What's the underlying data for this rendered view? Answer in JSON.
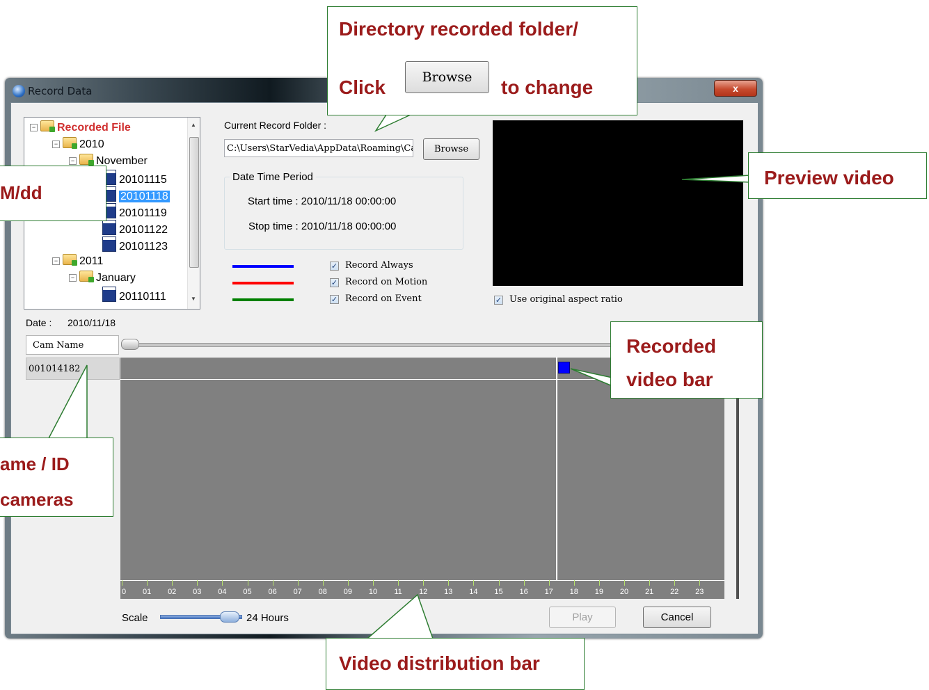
{
  "window": {
    "title": "Record Data",
    "close_label": "x"
  },
  "tree": {
    "root": "Recorded File",
    "year1": "2010",
    "month1": "November",
    "days1": [
      "20101115",
      "20101118",
      "20101119",
      "20101122",
      "20101123"
    ],
    "year2": "2011",
    "month2": "January",
    "days2": [
      "20110111"
    ]
  },
  "folder": {
    "label": "Current Record Folder :",
    "path": "C:\\Users\\StarVedia\\AppData\\Roaming\\Car",
    "browse_label": "Browse"
  },
  "period": {
    "title": "Date Time Period",
    "start": "Start time : 2010/11/18 00:00:00",
    "stop": "Stop time : 2010/11/18 00:00:00"
  },
  "legend": [
    {
      "label": "Record Always",
      "color": "#0000ff",
      "checked": true
    },
    {
      "label": "Record on Motion",
      "color": "#ff0000",
      "checked": true
    },
    {
      "label": "Record on Event",
      "color": "#008000",
      "checked": true
    }
  ],
  "preview": {
    "aspect_label": "Use original aspect ratio",
    "checked": true
  },
  "date": {
    "label": "Date :",
    "value": "2010/11/18"
  },
  "timeline": {
    "cam_header": "Cam Name",
    "cam_id": "001014182",
    "hours": [
      "0",
      "01",
      "02",
      "03",
      "04",
      "05",
      "06",
      "07",
      "08",
      "09",
      "10",
      "11",
      "12",
      "13",
      "14",
      "15",
      "16",
      "17",
      "18",
      "19",
      "20",
      "21",
      "22",
      "23"
    ]
  },
  "scale": {
    "label": "Scale",
    "value": "24 Hours"
  },
  "buttons": {
    "play": "Play",
    "cancel": "Cancel"
  },
  "callouts": {
    "directory_line1": "Directory recorded folder/",
    "directory_click": "Click",
    "directory_browse": "Browse",
    "directory_change": "to change",
    "date_format": "M/dd",
    "preview": "Preview video",
    "recorded_line1": "Recorded",
    "recorded_line2": "video bar",
    "camera_line1": "ame / ID",
    "camera_line2": "cameras",
    "distribution": "Video distribution bar"
  }
}
